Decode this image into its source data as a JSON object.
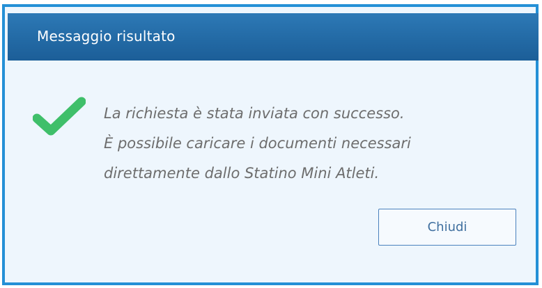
{
  "dialog": {
    "title": "Messaggio risultato",
    "icon": "check-icon",
    "icon_color": "#3fbf6a",
    "accent_color": "#2490d6",
    "message_lines": [
      "La richiesta è stata inviata con successo.",
      "È possibile caricare i documenti necessari",
      "direttamente dallo Statino Mini Atleti."
    ],
    "close_label": "Chiudi"
  }
}
